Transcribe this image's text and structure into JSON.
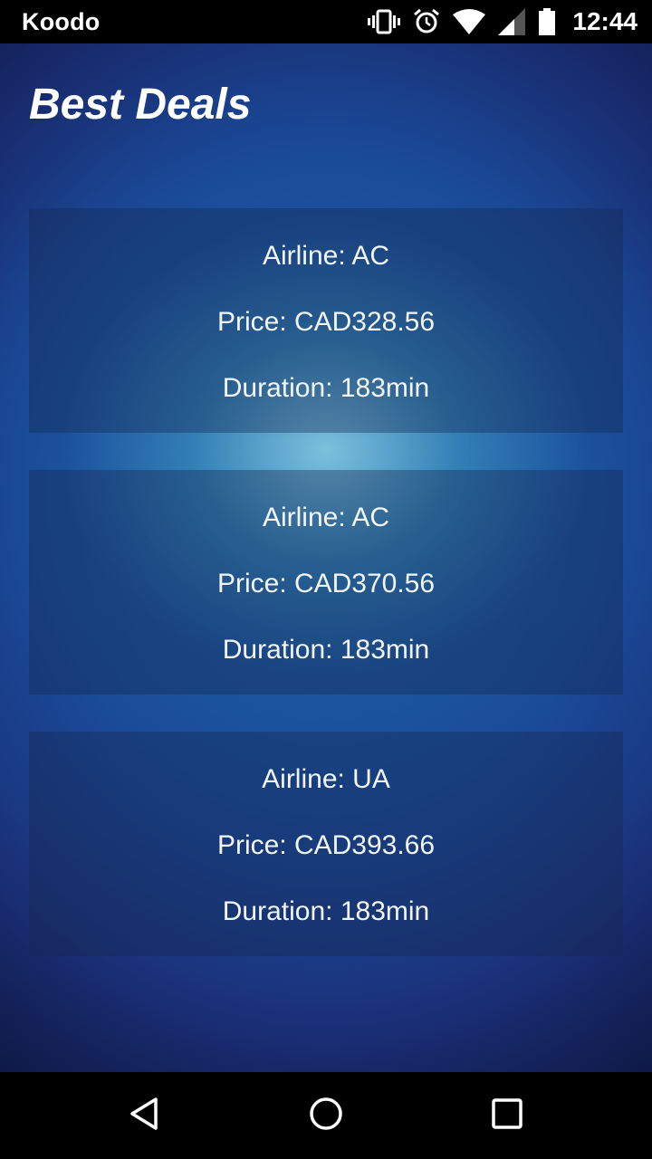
{
  "status_bar": {
    "carrier": "Koodo",
    "time": "12:44",
    "icons": [
      "vibrate-icon",
      "alarm-icon",
      "wifi-icon",
      "signal-icon",
      "battery-icon"
    ]
  },
  "page": {
    "title": "Best Deals"
  },
  "deals": [
    {
      "airline": "Airline: AC",
      "price": "Price: CAD328.56",
      "duration": "Duration: 183min"
    },
    {
      "airline": "Airline: AC",
      "price": "Price: CAD370.56",
      "duration": "Duration: 183min"
    },
    {
      "airline": "Airline: UA",
      "price": "Price: CAD393.66",
      "duration": "Duration: 183min"
    }
  ],
  "nav_bar": {
    "icons": [
      "back-icon",
      "home-icon",
      "recents-icon"
    ]
  },
  "colors": {
    "status_bar_bg": "#000000",
    "background_center": "#8cd2e6",
    "background_edge": "#1b2f78",
    "card_text": "#f2f6fa"
  }
}
